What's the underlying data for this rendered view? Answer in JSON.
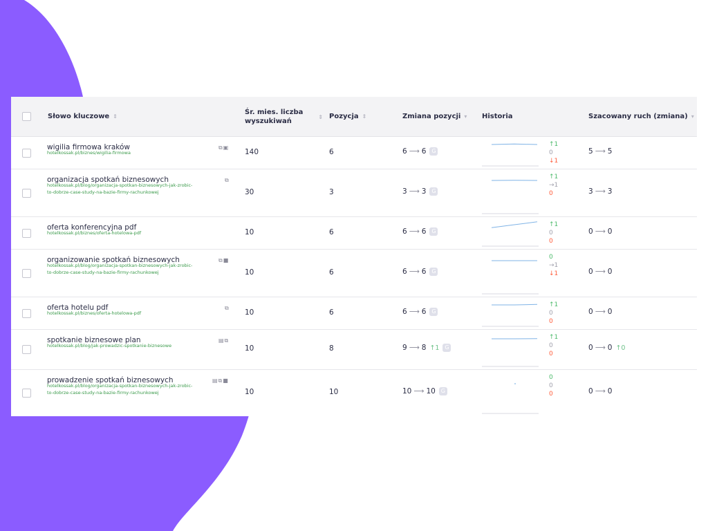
{
  "colors": {
    "accent_purple": "#8b5cff",
    "up_green": "#4cba6b",
    "down_red": "#ff5c3a",
    "neutral": "#a0a0ac",
    "url_green": "#3a9a4a",
    "header_bg": "#f3f3f5"
  },
  "table": {
    "headers": {
      "keyword": "Słowo kluczowe",
      "volume_line1": "Śr. mies. liczba",
      "volume_line2": "wyszukiwań",
      "position": "Pozycja",
      "change": "Zmiana pozycji",
      "history": "Historia",
      "traffic": "Szacowany ruch (zmiana)"
    },
    "rows": [
      {
        "keyword": "wigilia firmowa kraków",
        "url": "hotelkossak.pl/biznes/wigilia-firmowa",
        "icons": "⧉▣",
        "volume": "140",
        "position": "6",
        "change_from": "6",
        "change_to": "6",
        "history": [
          "↑1",
          "0",
          "↓1"
        ],
        "history_trend": [
          0.5,
          0.55,
          0.5
        ],
        "traffic_from": "5",
        "traffic_to": "5"
      },
      {
        "keyword": "organizacja spotkań biznesowych",
        "url": "hotelkossak.pl/blog/organizacja-spotkan-biznesowych-jak-zrobic-to-dobrze-case-study-na-bazie-firmy-rachunkowej",
        "icons": "⧉",
        "volume": "30",
        "position": "3",
        "change_from": "3",
        "change_to": "3",
        "history": [
          "↑1",
          "→1",
          "0"
        ],
        "history_trend": [
          0.5,
          0.52,
          0.5
        ],
        "traffic_from": "3",
        "traffic_to": "3"
      },
      {
        "keyword": "oferta konferencyjna pdf",
        "url": "hotelkossak.pl/biznes/oferta-hotelowa-pdf",
        "icons": "",
        "volume": "10",
        "position": "6",
        "change_from": "6",
        "change_to": "6",
        "history": [
          "↑1",
          "0",
          "0"
        ],
        "history_trend": [
          0.2,
          0.5,
          0.8
        ],
        "traffic_from": "0",
        "traffic_to": "0"
      },
      {
        "keyword": "organizowanie spotkań biznesowych",
        "url": "hotelkossak.pl/blog/organizacja-spotkan-biznesowych-jak-zrobic-to-dobrze-case-study-na-bazie-firmy-rachunkowej",
        "icons": "⧉■",
        "volume": "10",
        "position": "6",
        "change_from": "6",
        "change_to": "6",
        "history": [
          "0",
          "→1",
          "↓1"
        ],
        "history_trend": [
          0.5,
          0.5,
          0.5
        ],
        "traffic_from": "0",
        "traffic_to": "0"
      },
      {
        "keyword": "oferta hotelu pdf",
        "url": "hotelkossak.pl/biznes/oferta-hotelowa-pdf",
        "icons": "⧉",
        "volume": "10",
        "position": "6",
        "change_from": "6",
        "change_to": "6",
        "history": [
          "↑1",
          "0",
          "0"
        ],
        "history_trend": [
          0.5,
          0.5,
          0.55
        ],
        "traffic_from": "0",
        "traffic_to": "0"
      },
      {
        "keyword": "spotkanie biznesowe plan",
        "url": "hotelkossak.pl/blog/jak-prowadzic-spotkanie-biznesowe",
        "icons": "▤⧉",
        "volume": "10",
        "position": "8",
        "change_from": "9",
        "change_to": "8",
        "change_delta": "↑1",
        "history": [
          "↑1",
          "0",
          "0"
        ],
        "history_trend": [
          0.5,
          0.5,
          0.52
        ],
        "traffic_from": "0",
        "traffic_to": "0",
        "traffic_delta": "↑0"
      },
      {
        "keyword": "prowadzenie spotkań biznesowych",
        "url": "hotelkossak.pl/blog/organizacja-spotkan-biznesowych-jak-zrobic-to-dobrze-case-study-na-bazie-firmy-rachunkowej",
        "icons": "▤⧉■",
        "volume": "10",
        "position": "10",
        "change_from": "10",
        "change_to": "10",
        "history": [
          "0",
          "0",
          "0"
        ],
        "history_trend": [
          0.5
        ],
        "traffic_from": "0",
        "traffic_to": "0"
      }
    ]
  },
  "history_row_colors": [
    [
      "g",
      "n",
      "r"
    ],
    [
      "g",
      "n",
      "r"
    ],
    [
      "g",
      "n",
      "r"
    ],
    [
      "g",
      "n",
      "r"
    ],
    [
      "g",
      "n",
      "r"
    ],
    [
      "g",
      "n",
      "r"
    ],
    [
      "g",
      "n",
      "r"
    ]
  ]
}
